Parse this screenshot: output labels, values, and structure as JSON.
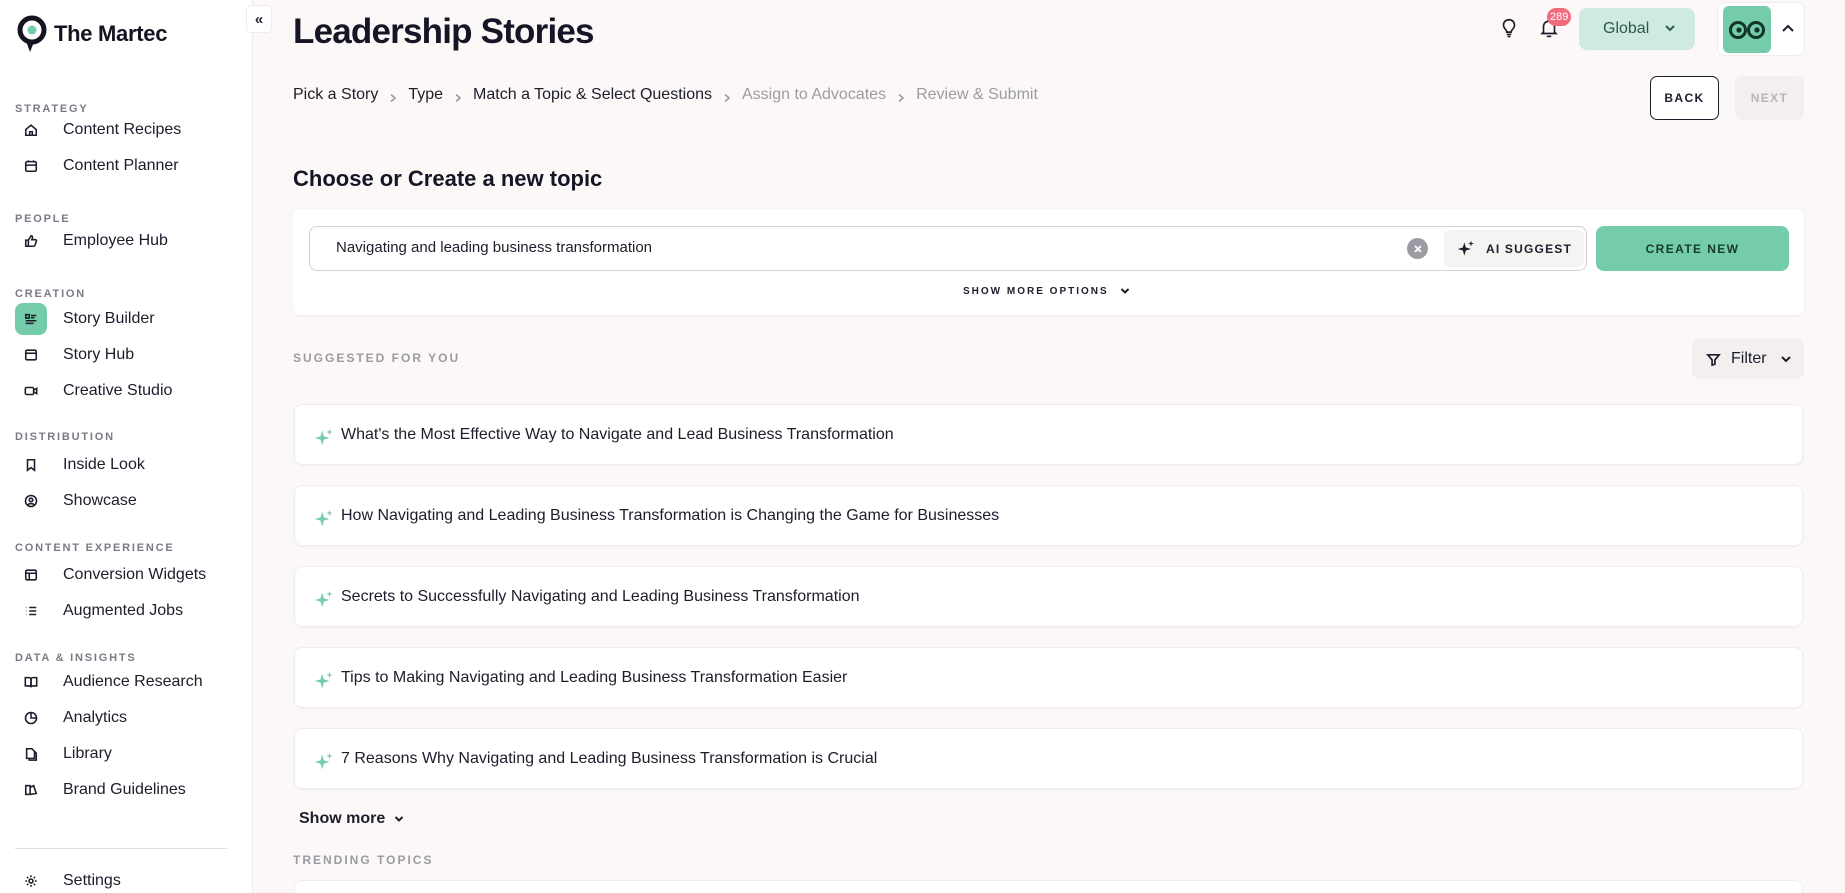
{
  "brand": {
    "name": "The Martec",
    "accent": "#74ccaa"
  },
  "sidebar": {
    "collapse_label": "«",
    "sections": [
      {
        "label": "STRATEGY"
      },
      {
        "label": "PEOPLE"
      },
      {
        "label": "CREATION"
      },
      {
        "label": "DISTRIBUTION"
      },
      {
        "label": "CONTENT EXPERIENCE"
      },
      {
        "label": "DATA & INSIGHTS"
      }
    ],
    "items": [
      {
        "label": "Content Recipes",
        "icon": "home-icon"
      },
      {
        "label": "Content Planner",
        "icon": "calendar-icon"
      },
      {
        "label": "Employee Hub",
        "icon": "thumbs-up-icon"
      },
      {
        "label": "Story Builder",
        "icon": "list-icon",
        "active": true
      },
      {
        "label": "Story Hub",
        "icon": "layout-icon"
      },
      {
        "label": "Creative Studio",
        "icon": "video-icon"
      },
      {
        "label": "Inside Look",
        "icon": "bookmark-icon"
      },
      {
        "label": "Showcase",
        "icon": "user-circle-icon"
      },
      {
        "label": "Conversion Widgets",
        "icon": "window-icon"
      },
      {
        "label": "Augmented Jobs",
        "icon": "bulleted-list-icon"
      },
      {
        "label": "Audience Research",
        "icon": "book-icon"
      },
      {
        "label": "Analytics",
        "icon": "pie-icon"
      },
      {
        "label": "Library",
        "icon": "files-icon"
      },
      {
        "label": "Brand Guidelines",
        "icon": "swatch-icon"
      },
      {
        "label": "Settings",
        "icon": "gear-icon"
      }
    ]
  },
  "header": {
    "title": "Leadership Stories",
    "notification_count": "289",
    "scope_selected": "Global"
  },
  "breadcrumb": {
    "steps": [
      {
        "label": "Pick a Story"
      },
      {
        "label": "Type"
      },
      {
        "label": "Match a Topic & Select Questions"
      },
      {
        "label": "Assign to Advocates"
      },
      {
        "label": "Review & Submit"
      }
    ],
    "back_label": "BACK",
    "next_label": "NEXT"
  },
  "topic": {
    "heading": "Choose or Create a new topic",
    "input_value": "Navigating and leading business transformation",
    "ai_suggest_label": "AI SUGGEST",
    "create_label": "CREATE NEW",
    "show_more_options_label": "SHOW MORE OPTIONS"
  },
  "suggested": {
    "label": "SUGGESTED FOR YOU",
    "filter_label": "Filter",
    "items": [
      {
        "text": "What's the Most Effective Way to Navigate and Lead Business Transformation"
      },
      {
        "text": "How Navigating and Leading Business Transformation is Changing the Game for Businesses"
      },
      {
        "text": "Secrets to Successfully Navigating and Leading Business Transformation"
      },
      {
        "text": "Tips to Making Navigating and Leading Business Transformation Easier"
      },
      {
        "text": "7 Reasons Why Navigating and Leading Business Transformation is Crucial"
      }
    ],
    "show_more_label": "Show more"
  },
  "trending": {
    "label": "TRENDING TOPICS"
  }
}
